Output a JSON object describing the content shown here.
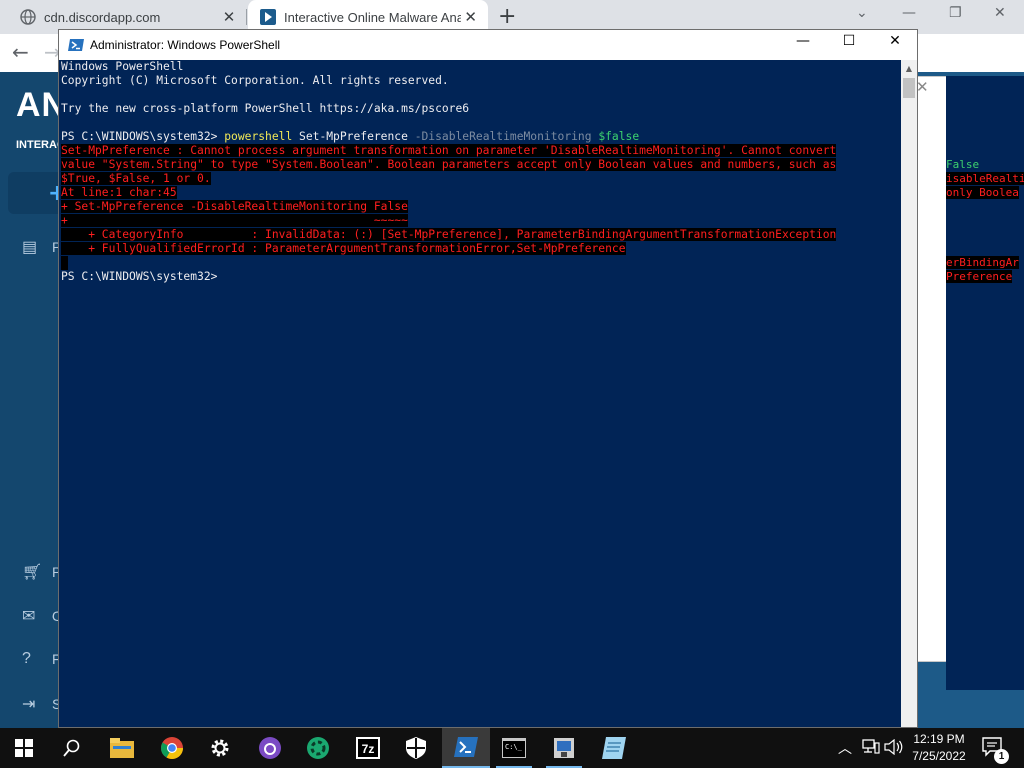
{
  "browser": {
    "tabs": [
      {
        "title": "cdn.discordapp.com",
        "favicon": "globe-icon"
      },
      {
        "title": "Interactive Online Malware Analy",
        "favicon": "anyrun-icon"
      }
    ],
    "newtab_glyph": "+",
    "close_glyph": "✕"
  },
  "site": {
    "logo": "ANY",
    "logo_sub": "INTERACT",
    "sidebar": [
      {
        "icon": "file-icon",
        "label": "P"
      },
      {
        "icon": "cart-icon",
        "label": "P"
      },
      {
        "icon": "mail-icon",
        "label": "C"
      },
      {
        "icon": "help-icon",
        "label": "F"
      },
      {
        "icon": "logout-icon",
        "label": "S"
      }
    ],
    "background_console_lines": [
      {
        "text": "False",
        "color": "#3dd16e"
      },
      {
        "text": "isableRealti",
        "color": "#ff1f1f"
      },
      {
        "text": "only Boolea",
        "color": "#ff1f1f"
      },
      {
        "text": "erBindingAr",
        "color": "#ff1f1f"
      },
      {
        "text": "Preference",
        "color": "#ff1f1f"
      }
    ]
  },
  "powershell": {
    "title": "Administrator: Windows PowerShell",
    "header": [
      "Windows PowerShell",
      "Copyright (C) Microsoft Corporation. All rights reserved.",
      "",
      "Try the new cross-platform PowerShell https://aka.ms/pscore6",
      ""
    ],
    "command": {
      "prompt": "PS C:\\WINDOWS\\system32> ",
      "exe": "powershell",
      "cmdlet": " Set-MpPreference ",
      "param": "-DisableRealtimeMonitoring ",
      "value": "$false"
    },
    "error_lines": [
      "Set-MpPreference : Cannot process argument transformation on parameter 'DisableRealtimeMonitoring'. Cannot convert",
      "value \"System.String\" to type \"System.Boolean\". Boolean parameters accept only Boolean values and numbers, such as",
      "$True, $False, 1 or 0.",
      "At line:1 char:45",
      "+ Set-MpPreference -DisableRealtimeMonitoring False",
      "+                                             ~~~~~",
      "    + CategoryInfo          : InvalidData: (:) [Set-MpPreference], ParameterBindingArgumentTransformationException",
      "    + FullyQualifiedErrorId : ParameterArgumentTransformationError,Set-MpPreference"
    ],
    "final_prompt": "PS C:\\WINDOWS\\system32>",
    "controls": {
      "minimize": "—",
      "maximize": "☐",
      "close": "✕"
    }
  },
  "taskbar": {
    "items": [
      {
        "name": "start-button-icon"
      },
      {
        "name": "search-icon"
      },
      {
        "name": "file-explorer-icon"
      },
      {
        "name": "chrome-icon"
      },
      {
        "name": "settings-icon"
      },
      {
        "name": "github-icon"
      },
      {
        "name": "app-circle-icon"
      },
      {
        "name": "7zip-icon"
      },
      {
        "name": "shield-icon"
      },
      {
        "name": "powershell-icon"
      },
      {
        "name": "cmd-icon"
      },
      {
        "name": "network-app-icon"
      },
      {
        "name": "notepad-icon"
      }
    ],
    "time": "12:19 PM",
    "date": "7/25/2022",
    "notification_count": "1",
    "colors": {
      "accent": "#76b9ed",
      "ps_background": "#012456",
      "error_text": "#ff1f1f"
    }
  }
}
